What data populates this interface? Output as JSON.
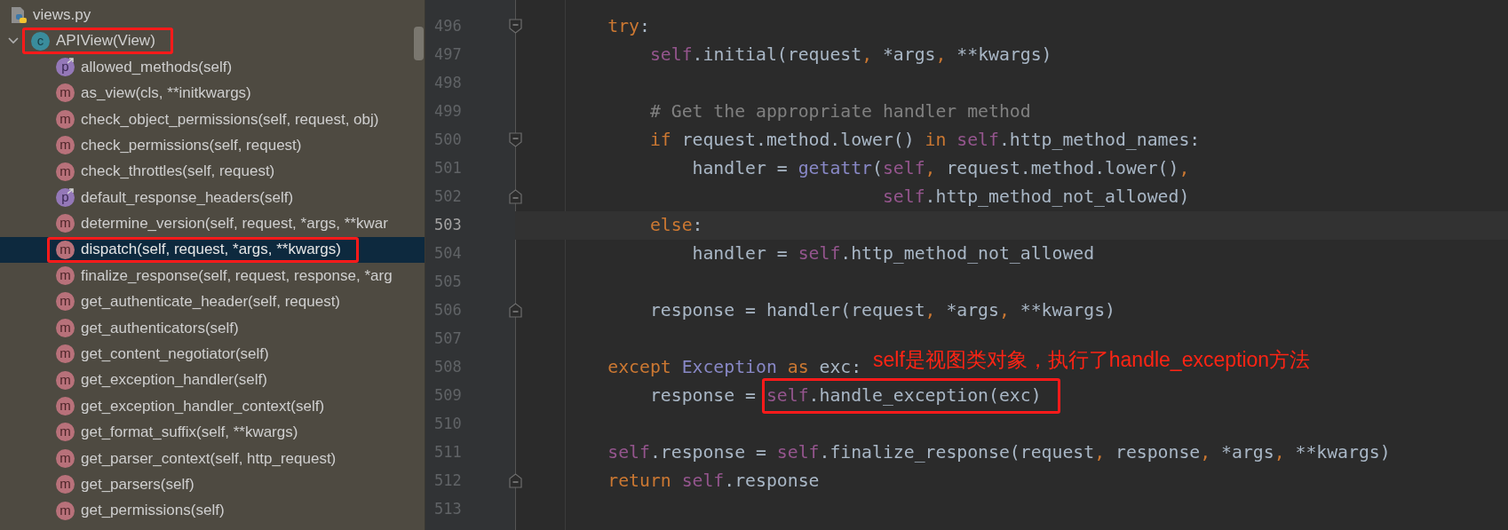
{
  "project_tree": {
    "file": {
      "name": "views.py"
    },
    "root": {
      "label": "APIView(View)",
      "kind": "class",
      "badge": "c",
      "expanded": true,
      "selected": false,
      "boxed": true,
      "children": [
        {
          "label": "allowed_methods(self)",
          "kind": "property",
          "badge": "p",
          "selected": false,
          "boxed": false
        },
        {
          "label": "as_view(cls, **initkwargs)",
          "kind": "method",
          "badge": "m",
          "selected": false,
          "boxed": false
        },
        {
          "label": "check_object_permissions(self, request, obj)",
          "kind": "method",
          "badge": "m",
          "selected": false,
          "boxed": false
        },
        {
          "label": "check_permissions(self, request)",
          "kind": "method",
          "badge": "m",
          "selected": false,
          "boxed": false
        },
        {
          "label": "check_throttles(self, request)",
          "kind": "method",
          "badge": "m",
          "selected": false,
          "boxed": false
        },
        {
          "label": "default_response_headers(self)",
          "kind": "property",
          "badge": "p",
          "selected": false,
          "boxed": false
        },
        {
          "label": "determine_version(self, request, *args, **kwar",
          "kind": "method",
          "badge": "m",
          "selected": false,
          "boxed": false
        },
        {
          "label": "dispatch(self, request, *args, **kwargs)",
          "kind": "method",
          "badge": "m",
          "selected": true,
          "boxed": true
        },
        {
          "label": "finalize_response(self, request, response, *arg",
          "kind": "method",
          "badge": "m",
          "selected": false,
          "boxed": false
        },
        {
          "label": "get_authenticate_header(self, request)",
          "kind": "method",
          "badge": "m",
          "selected": false,
          "boxed": false
        },
        {
          "label": "get_authenticators(self)",
          "kind": "method",
          "badge": "m",
          "selected": false,
          "boxed": false
        },
        {
          "label": "get_content_negotiator(self)",
          "kind": "method",
          "badge": "m",
          "selected": false,
          "boxed": false
        },
        {
          "label": "get_exception_handler(self)",
          "kind": "method",
          "badge": "m",
          "selected": false,
          "boxed": false
        },
        {
          "label": "get_exception_handler_context(self)",
          "kind": "method",
          "badge": "m",
          "selected": false,
          "boxed": false
        },
        {
          "label": "get_format_suffix(self, **kwargs)",
          "kind": "method",
          "badge": "m",
          "selected": false,
          "boxed": false
        },
        {
          "label": "get_parser_context(self, http_request)",
          "kind": "method",
          "badge": "m",
          "selected": false,
          "boxed": false
        },
        {
          "label": "get_parsers(self)",
          "kind": "method",
          "badge": "m",
          "selected": false,
          "boxed": false
        },
        {
          "label": "get_permissions(self)",
          "kind": "method",
          "badge": "m",
          "selected": false,
          "boxed": false
        }
      ]
    }
  },
  "editor": {
    "lines": [
      {
        "number": "496",
        "fold_start": true,
        "fold_end": false,
        "current": false,
        "tokens": [
          {
            "text": "        try",
            "kind": "keyword"
          },
          {
            "text": ":",
            "kind": "plain"
          }
        ]
      },
      {
        "number": "497",
        "fold_start": false,
        "fold_end": false,
        "current": false,
        "tokens": [
          {
            "text": "            self",
            "kind": "self"
          },
          {
            "text": ".initial(request",
            "kind": "plain"
          },
          {
            "text": ",",
            "kind": "comma"
          },
          {
            "text": " *args",
            "kind": "plain"
          },
          {
            "text": ",",
            "kind": "comma"
          },
          {
            "text": " **kwargs)",
            "kind": "plain"
          }
        ]
      },
      {
        "number": "498",
        "fold_start": false,
        "fold_end": false,
        "current": false
      },
      {
        "number": "499",
        "fold_start": false,
        "fold_end": false,
        "current": false,
        "tokens": [
          {
            "text": "            # Get the appropriate handler method",
            "kind": "comment"
          }
        ]
      },
      {
        "number": "500",
        "fold_start": true,
        "fold_end": false,
        "current": false,
        "tokens": [
          {
            "text": "            if",
            "kind": "keyword"
          },
          {
            "text": " request.method.lower() ",
            "kind": "plain"
          },
          {
            "text": "in",
            "kind": "keyword"
          },
          {
            "text": " self",
            "kind": "self"
          },
          {
            "text": ".http_method_names:",
            "kind": "plain"
          }
        ]
      },
      {
        "number": "501",
        "fold_start": false,
        "fold_end": false,
        "current": false,
        "tokens": [
          {
            "text": "                handler = ",
            "kind": "plain"
          },
          {
            "text": "getattr",
            "kind": "builtin"
          },
          {
            "text": "(",
            "kind": "plain"
          },
          {
            "text": "self",
            "kind": "self"
          },
          {
            "text": ",",
            "kind": "comma"
          },
          {
            "text": " request.method.lower()",
            "kind": "plain"
          },
          {
            "text": ",",
            "kind": "comma"
          }
        ]
      },
      {
        "number": "502",
        "fold_start": false,
        "fold_end": true,
        "current": false,
        "tokens": [
          {
            "text": "                                  self",
            "kind": "self"
          },
          {
            "text": ".http_method_not_allowed)",
            "kind": "plain"
          }
        ]
      },
      {
        "number": "503",
        "fold_start": false,
        "fold_end": false,
        "current": true,
        "tokens": [
          {
            "text": "            else",
            "kind": "keyword"
          },
          {
            "text": ":",
            "kind": "plain"
          }
        ]
      },
      {
        "number": "504",
        "fold_start": false,
        "fold_end": false,
        "current": false,
        "tokens": [
          {
            "text": "                handler = ",
            "kind": "plain"
          },
          {
            "text": "self",
            "kind": "self"
          },
          {
            "text": ".http_method_not_allowed",
            "kind": "plain"
          }
        ]
      },
      {
        "number": "505",
        "fold_start": false,
        "fold_end": false,
        "current": false
      },
      {
        "number": "506",
        "fold_start": false,
        "fold_end": true,
        "current": false,
        "tokens": [
          {
            "text": "            response = handler(request",
            "kind": "plain"
          },
          {
            "text": ",",
            "kind": "comma"
          },
          {
            "text": " *args",
            "kind": "plain"
          },
          {
            "text": ",",
            "kind": "comma"
          },
          {
            "text": " **kwargs)",
            "kind": "plain"
          }
        ]
      },
      {
        "number": "507",
        "fold_start": false,
        "fold_end": false,
        "current": false
      },
      {
        "number": "508",
        "fold_start": false,
        "fold_end": false,
        "current": false,
        "tokens": [
          {
            "text": "        except",
            "kind": "keyword"
          },
          {
            "text": " Exception",
            "kind": "builtin"
          },
          {
            "text": " as",
            "kind": "keyword"
          },
          {
            "text": " exc:",
            "kind": "plain"
          }
        ]
      },
      {
        "number": "509",
        "fold_start": false,
        "fold_end": false,
        "current": false,
        "tokens": [
          {
            "text": "            response = ",
            "kind": "plain"
          },
          {
            "text": "self",
            "kind": "self",
            "boxed": true
          },
          {
            "text": ".handle_exception(exc)",
            "kind": "plain",
            "boxed": true
          }
        ]
      },
      {
        "number": "510",
        "fold_start": false,
        "fold_end": false,
        "current": false
      },
      {
        "number": "511",
        "fold_start": false,
        "fold_end": false,
        "current": false,
        "tokens": [
          {
            "text": "        self",
            "kind": "self"
          },
          {
            "text": ".response = ",
            "kind": "plain"
          },
          {
            "text": "self",
            "kind": "self"
          },
          {
            "text": ".finalize_response(request",
            "kind": "plain"
          },
          {
            "text": ",",
            "kind": "comma"
          },
          {
            "text": " response",
            "kind": "plain"
          },
          {
            "text": ",",
            "kind": "comma"
          },
          {
            "text": " *args",
            "kind": "plain"
          },
          {
            "text": ",",
            "kind": "comma"
          },
          {
            "text": " **kwargs)",
            "kind": "plain"
          }
        ]
      },
      {
        "number": "512",
        "fold_start": false,
        "fold_end": true,
        "current": false,
        "tokens": [
          {
            "text": "        return",
            "kind": "keyword"
          },
          {
            "text": " self",
            "kind": "self"
          },
          {
            "text": ".response",
            "kind": "plain"
          }
        ]
      },
      {
        "number": "513",
        "fold_start": false,
        "fold_end": false,
        "current": false
      }
    ]
  },
  "annotation": {
    "text": "self是视图类对象，执行了handle_exception方法"
  }
}
